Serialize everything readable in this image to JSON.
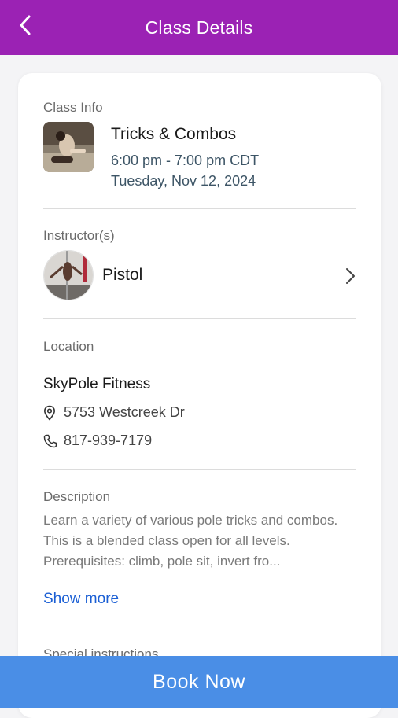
{
  "header": {
    "title": "Class Details",
    "back_icon": "chevron-left-icon",
    "color": "#9b22b4"
  },
  "class_info": {
    "section_label": "Class Info",
    "title": "Tricks & Combos",
    "time": "6:00 pm - 7:00 pm CDT",
    "date": "Tuesday, Nov 12, 2024"
  },
  "instructor": {
    "section_label": "Instructor(s)",
    "name": "Pistol"
  },
  "location": {
    "section_label": "Location",
    "name": "SkyPole Fitness",
    "address": "5753 Westcreek Dr",
    "phone": "817-939-7179"
  },
  "description": {
    "section_label": "Description",
    "text": "Learn a variety of various pole tricks and combos. This is a blended class open for all levels. Prerequisites: climb, pole sit, invert fro...",
    "show_more_label": "Show more"
  },
  "special_instructions": {
    "section_label": "Special instructions"
  },
  "footer": {
    "book_label": "Book Now",
    "color": "#4a8ee6"
  }
}
